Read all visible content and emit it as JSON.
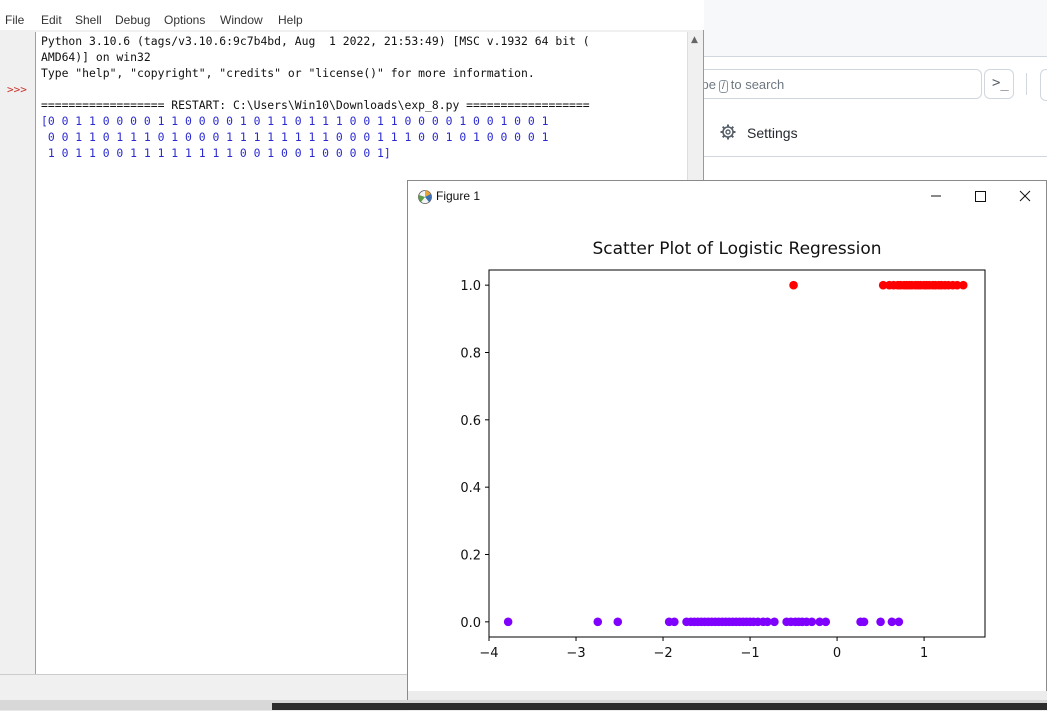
{
  "github": {
    "search_placeholder_pre": "ype",
    "search_slash": "/",
    "search_placeholder_post": "to search",
    "command_label": ">_",
    "settings_label": "Settings"
  },
  "idle": {
    "menu": [
      "File",
      "Edit",
      "Shell",
      "Debug",
      "Options",
      "Window",
      "Help"
    ],
    "prompt": ">>>",
    "lines": [
      {
        "text": "Python 3.10.6 (tags/v3.10.6:9c7b4bd, Aug  1 2022, 21:53:49) [MSC v.1932 64 bit (",
        "kind": "normal"
      },
      {
        "text": "AMD64)] on win32",
        "kind": "normal"
      },
      {
        "text": "Type \"help\", \"copyright\", \"credits\" or \"license()\" for more information.",
        "kind": "normal"
      },
      {
        "text": "",
        "kind": "normal"
      },
      {
        "text": "================== RESTART: C:\\Users\\Win10\\Downloads\\exp_8.py ==================",
        "kind": "normal"
      },
      {
        "text": "[0 0 1 1 0 0 0 0 1 1 0 0 0 0 1 0 1 1 0 1 1 1 0 0 1 1 0 0 0 0 1 0 0 1 0 0 1",
        "kind": "stdout"
      },
      {
        "text": " 0 0 1 1 0 1 1 1 0 1 0 0 0 1 1 1 1 1 1 1 1 0 0 0 1 1 1 0 0 1 0 1 0 0 0 0 1",
        "kind": "stdout"
      },
      {
        "text": " 1 0 1 1 0 0 1 1 1 1 1 1 1 1 0 0 1 0 0 1 0 0 0 0 1]",
        "kind": "stdout"
      }
    ]
  },
  "figure": {
    "window_title": "Figure 1",
    "colors": {
      "class1": "#ff0000",
      "class0": "#7f00ff"
    }
  },
  "chart_data": {
    "type": "scatter",
    "title": "Scatter Plot of Logistic Regression",
    "xlabel": "",
    "ylabel": "",
    "xlim": [
      -4.0,
      1.7
    ],
    "ylim": [
      -0.045,
      1.045
    ],
    "xticks": [
      -4,
      -3,
      -2,
      -1,
      0,
      1
    ],
    "xtick_labels": [
      "−4",
      "−3",
      "−2",
      "−1",
      "0",
      "1"
    ],
    "yticks": [
      0.0,
      0.2,
      0.4,
      0.6,
      0.8,
      1.0
    ],
    "ytick_labels": [
      "0.0",
      "0.2",
      "0.4",
      "0.6",
      "0.8",
      "1.0"
    ],
    "grid": false,
    "series": [
      {
        "color": "#ff0000",
        "points": [
          [
            -0.5,
            1
          ],
          [
            0.53,
            1
          ],
          [
            0.6,
            1
          ],
          [
            0.65,
            1
          ],
          [
            0.7,
            1
          ],
          [
            0.73,
            1
          ],
          [
            0.77,
            1
          ],
          [
            0.8,
            1
          ],
          [
            0.83,
            1
          ],
          [
            0.86,
            1
          ],
          [
            0.9,
            1
          ],
          [
            0.93,
            1
          ],
          [
            0.96,
            1
          ],
          [
            1.0,
            1
          ],
          [
            1.03,
            1
          ],
          [
            1.06,
            1
          ],
          [
            1.1,
            1
          ],
          [
            1.13,
            1
          ],
          [
            1.17,
            1
          ],
          [
            1.2,
            1
          ],
          [
            1.24,
            1
          ],
          [
            1.28,
            1
          ],
          [
            1.33,
            1
          ],
          [
            1.38,
            1
          ],
          [
            1.45,
            1
          ]
        ]
      },
      {
        "color": "#7f00ff",
        "points": [
          [
            -3.78,
            0
          ],
          [
            -2.75,
            0
          ],
          [
            -2.52,
            0
          ],
          [
            -1.93,
            0
          ],
          [
            -1.87,
            0
          ],
          [
            -1.73,
            0
          ],
          [
            -1.68,
            0
          ],
          [
            -1.64,
            0
          ],
          [
            -1.6,
            0
          ],
          [
            -1.56,
            0
          ],
          [
            -1.52,
            0
          ],
          [
            -1.48,
            0
          ],
          [
            -1.44,
            0
          ],
          [
            -1.4,
            0
          ],
          [
            -1.36,
            0
          ],
          [
            -1.32,
            0
          ],
          [
            -1.28,
            0
          ],
          [
            -1.24,
            0
          ],
          [
            -1.2,
            0
          ],
          [
            -1.16,
            0
          ],
          [
            -1.12,
            0
          ],
          [
            -1.08,
            0
          ],
          [
            -1.04,
            0
          ],
          [
            -1.0,
            0
          ],
          [
            -0.96,
            0
          ],
          [
            -0.91,
            0
          ],
          [
            -0.85,
            0
          ],
          [
            -0.8,
            0
          ],
          [
            -0.72,
            0
          ],
          [
            -0.58,
            0
          ],
          [
            -0.53,
            0
          ],
          [
            -0.48,
            0
          ],
          [
            -0.44,
            0
          ],
          [
            -0.4,
            0
          ],
          [
            -0.35,
            0
          ],
          [
            -0.29,
            0
          ],
          [
            -0.2,
            0
          ],
          [
            -0.13,
            0
          ],
          [
            0.27,
            0
          ],
          [
            0.31,
            0
          ],
          [
            0.5,
            0
          ],
          [
            0.63,
            0
          ],
          [
            0.71,
            0
          ]
        ]
      }
    ]
  }
}
